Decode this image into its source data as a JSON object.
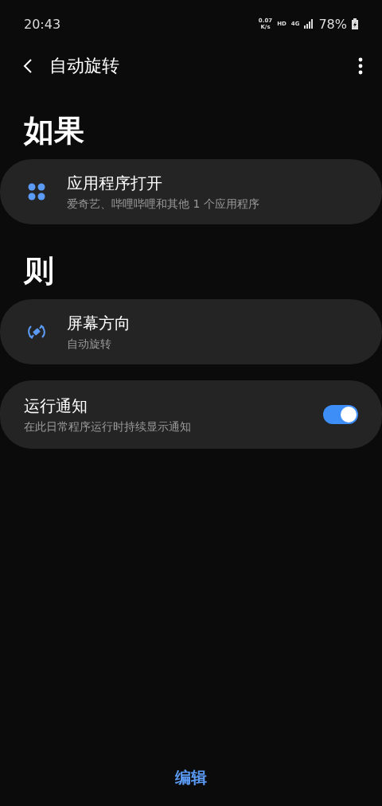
{
  "status_bar": {
    "time": "20:43",
    "net_speed": "0.07",
    "net_unit": "K/s",
    "hd": "HD",
    "network": "4G",
    "battery": "78%"
  },
  "app_bar": {
    "title": "自动旋转"
  },
  "sections": [
    {
      "heading": "如果",
      "cards": [
        {
          "kind": "apps",
          "title": "应用程序打开",
          "subtitle": "爱奇艺、哔哩哔哩和其他 1 个应用程序"
        }
      ]
    },
    {
      "heading": "则",
      "cards": [
        {
          "kind": "rotation",
          "title": "屏幕方向",
          "subtitle": "自动旋转"
        }
      ]
    }
  ],
  "notification": {
    "title": "运行通知",
    "subtitle": "在此日常程序运行时持续显示通知",
    "checked": true
  },
  "bottom_button": "编辑"
}
